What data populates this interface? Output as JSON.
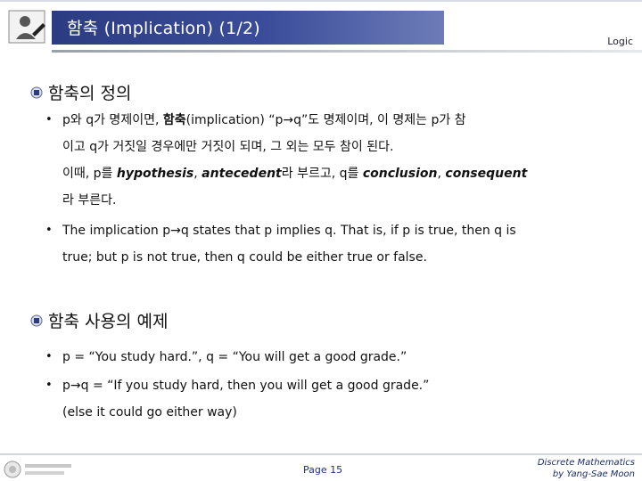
{
  "header": {
    "title": "함축 (Implication) (1/2)",
    "course": "Logic"
  },
  "sections": [
    {
      "heading": "함축의 정의"
    },
    {
      "heading": "함축 사용의 예제"
    }
  ],
  "def_bullet_ko": {
    "l1_a": "p와 q가 명제이면, ",
    "l1_b": "함축",
    "l1_c": "(implication) “p→q”도 명제이며, 이 명제는 p가 참",
    "l2": "이고 q가 거짓일 경우에만 거짓이 되며, 그 외는 모두 참이 된다.",
    "l3_a": "이때, p를 ",
    "l3_b": "hypothesis",
    "l3_c": ", ",
    "l3_d": "antecedent",
    "l3_e": "라 부르고, q를 ",
    "l3_f": "conclusion",
    "l3_g": ", ",
    "l3_h": "consequent",
    "l4": "라 부른다."
  },
  "def_bullet_en": {
    "l1": "The implication p→q states that p implies q. That is, if p is true, then q is",
    "l2": "true; but p is not true, then q could be either true or false."
  },
  "example_bullets": {
    "b1": "p = “You study hard.”, q = “You will get a good grade.”",
    "b2_l1": "p→q = “If you study hard, then you will get a good grade.”",
    "b2_l2": "(else it could go either way)"
  },
  "footer": {
    "page": "Page 15",
    "credit_l1": "Discrete Mathematics",
    "credit_l2": "by Yang-Sae Moon"
  }
}
